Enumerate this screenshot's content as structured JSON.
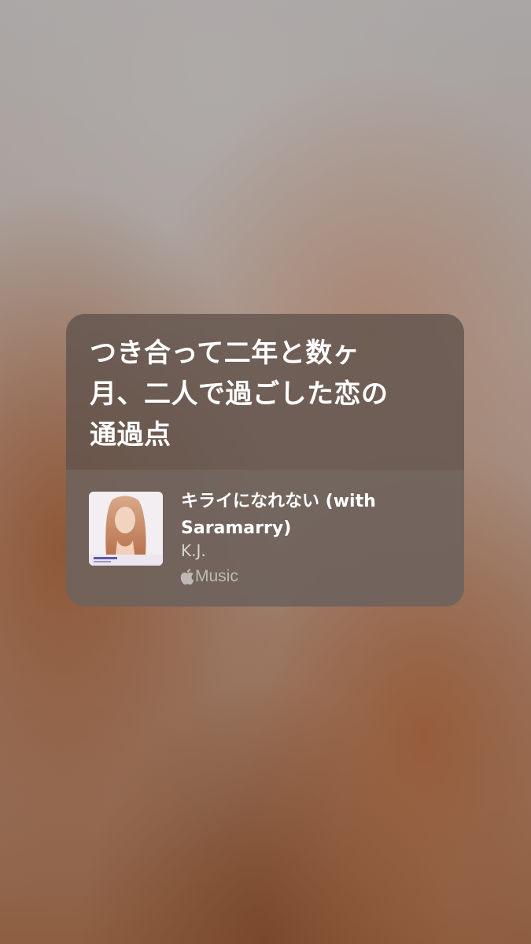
{
  "lyric_card": {
    "lyric_lines": [
      "つき合って二年と数ヶ",
      "月、二人で過ごした恋の",
      "通過点"
    ]
  },
  "track": {
    "title_lines": [
      "キライになれない (with",
      "Saramarry)"
    ],
    "artist": "K.J.",
    "service_label": "Music",
    "service_icon": "apple-logo-icon",
    "artwork_icon": "album-artwork"
  },
  "colors": {
    "card_background": "#5f524c",
    "lyric_text": "#ffffff",
    "secondary_text": "#cfc8c4"
  }
}
